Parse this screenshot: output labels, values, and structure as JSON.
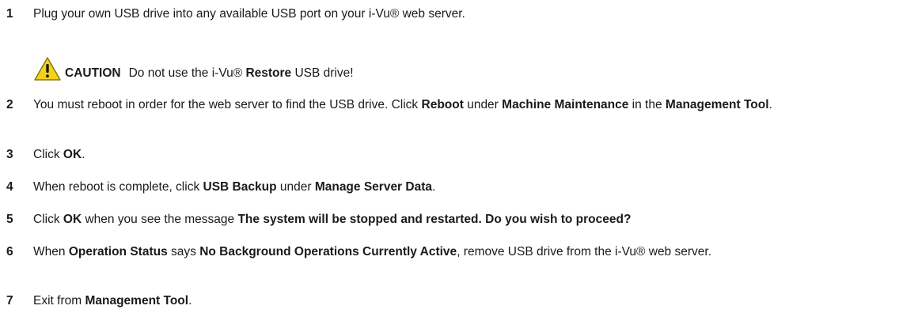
{
  "steps": [
    {
      "num": "1",
      "parts": [
        {
          "t": "Plug your own USB drive into any available USB port on your i-Vu® web server.",
          "b": false
        }
      ]
    },
    {
      "num": "2",
      "parts": [
        {
          "t": "You must reboot in order for the web server to find the USB drive. Click ",
          "b": false
        },
        {
          "t": "Reboot",
          "b": true
        },
        {
          "t": " under ",
          "b": false
        },
        {
          "t": "Machine Maintenance",
          "b": true
        },
        {
          "t": " in the ",
          "b": false
        },
        {
          "t": "Management Tool",
          "b": true
        },
        {
          "t": ".",
          "b": false
        }
      ]
    },
    {
      "num": "3",
      "parts": [
        {
          "t": "Click ",
          "b": false
        },
        {
          "t": "OK",
          "b": true
        },
        {
          "t": ".",
          "b": false
        }
      ]
    },
    {
      "num": "4",
      "parts": [
        {
          "t": "When reboot is complete, click ",
          "b": false
        },
        {
          "t": "USB Backup",
          "b": true
        },
        {
          "t": " under ",
          "b": false
        },
        {
          "t": "Manage Server Data",
          "b": true
        },
        {
          "t": ".",
          "b": false
        }
      ]
    },
    {
      "num": "5",
      "parts": [
        {
          "t": "Click ",
          "b": false
        },
        {
          "t": "OK",
          "b": true
        },
        {
          "t": " when you see the message ",
          "b": false
        },
        {
          "t": "The system will be stopped and restarted. Do you wish to proceed?",
          "b": true
        }
      ]
    },
    {
      "num": "6",
      "parts": [
        {
          "t": "When ",
          "b": false
        },
        {
          "t": "Operation Status",
          "b": true
        },
        {
          "t": " says ",
          "b": false
        },
        {
          "t": "No Background Operations Currently Active",
          "b": true
        },
        {
          "t": ", remove USB drive from the i-Vu® web server.",
          "b": false
        }
      ]
    },
    {
      "num": "7",
      "parts": [
        {
          "t": "Exit from ",
          "b": false
        },
        {
          "t": "Management Tool",
          "b": true
        },
        {
          "t": ".",
          "b": false
        }
      ]
    }
  ],
  "caution": {
    "icon": "warning-triangle-icon",
    "label": "CAUTION",
    "text_before": "Do not use the i-Vu® ",
    "text_bold": "Restore",
    "text_after": " USB drive!",
    "icon_colors": {
      "fill": "#f2d21b",
      "stroke": "#8a7a10",
      "mark": "#1a1a1a"
    }
  }
}
